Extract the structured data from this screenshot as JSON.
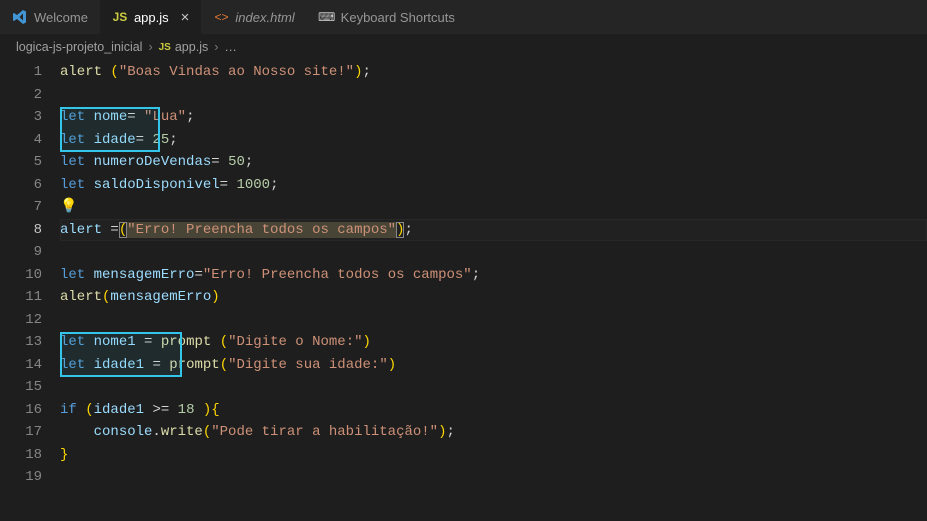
{
  "tabs": [
    {
      "label": "Welcome",
      "icon": "vs",
      "active": false
    },
    {
      "label": "app.js",
      "icon": "js",
      "active": true,
      "close": "×"
    },
    {
      "label": "index.html",
      "icon": "html",
      "active": false,
      "italic": true
    },
    {
      "label": "Keyboard Shortcuts",
      "icon": "kb",
      "active": false
    }
  ],
  "breadcrumb": {
    "project": "logica-js-projeto_inicial",
    "file": "app.js",
    "ellipsis": "…"
  },
  "lines": {
    "l1_fn": "alert",
    "l1_str": "\"Boas Vindas ao Nosso site!\"",
    "l3_kw": "let",
    "l3_var": "nome",
    "l3_str": "\"Lua\"",
    "l4_kw": "let",
    "l4_var": "idade",
    "l4_num": "25",
    "l5_kw": "let",
    "l5_var": "numeroDeVendas",
    "l5_num": "50",
    "l6_kw": "let",
    "l6_var": "saldoDisponivel",
    "l6_num": "1000",
    "l8_var": "alert",
    "l8_str": "\"Erro! Preencha todos os campos\"",
    "l10_kw": "let",
    "l10_var": "mensagemErro",
    "l10_str": "\"Erro! Preencha todos os campos\"",
    "l11_fn": "alert",
    "l11_var": "mensagemErro",
    "l13_kw": "let",
    "l13_var": "nome1",
    "l13_fn": "prompt",
    "l13_str": "\"Digite o Nome:\"",
    "l14_kw": "let",
    "l14_var": "idade1",
    "l14_fn": "prompt",
    "l14_str": "\"Digite sua idade:\"",
    "l16_kw": "if",
    "l16_var": "idade1",
    "l16_num": "18",
    "l17_obj": "console",
    "l17_fn": "write",
    "l17_str": "\"Pode tirar a habilitação!\""
  },
  "line_numbers": [
    "1",
    "2",
    "3",
    "4",
    "5",
    "6",
    "7",
    "8",
    "9",
    "10",
    "11",
    "12",
    "13",
    "14",
    "15",
    "16",
    "17",
    "18",
    "19"
  ],
  "glyphs": {
    "bulb": "💡",
    "sep": "›"
  }
}
